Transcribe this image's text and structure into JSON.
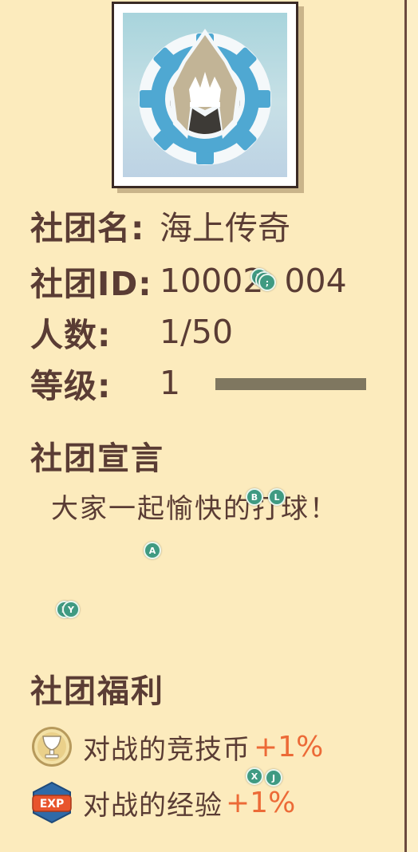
{
  "club": {
    "emblem_icon": "crown-gear-emblem-icon",
    "name_label": "社团名:",
    "name_value": "海上传奇",
    "id_label": "社团ID:",
    "id_value": "10002",
    "id_value_tail": "004",
    "members_label": "人数:",
    "members_value": "1/50",
    "level_label": "等级:",
    "level_value": "1",
    "level_progress": 1.0
  },
  "declaration": {
    "title": "社团宣言",
    "text": "大家一起愉快的打球！"
  },
  "benefits": {
    "title": "社团福利",
    "items": [
      {
        "icon": "trophy-coin-icon",
        "label": "对战的竞技币",
        "bonus": "+1%"
      },
      {
        "icon": "exp-badge-icon",
        "label": "对战的经验",
        "bonus": "+1%"
      }
    ]
  },
  "markers": [
    {
      "text": "R"
    },
    {
      "text": "T"
    },
    {
      "text": ";"
    },
    {
      "text": "B"
    },
    {
      "text": "L"
    },
    {
      "text": "A"
    },
    {
      "text": "K"
    },
    {
      "text": "Y"
    },
    {
      "text": "X"
    },
    {
      "text": "J"
    }
  ],
  "colors": {
    "background": "#fcebbd",
    "text": "#5a3c34",
    "bonus": "#ec6a37",
    "level_bar": "#7f7760",
    "marker": "#3f9a82"
  }
}
